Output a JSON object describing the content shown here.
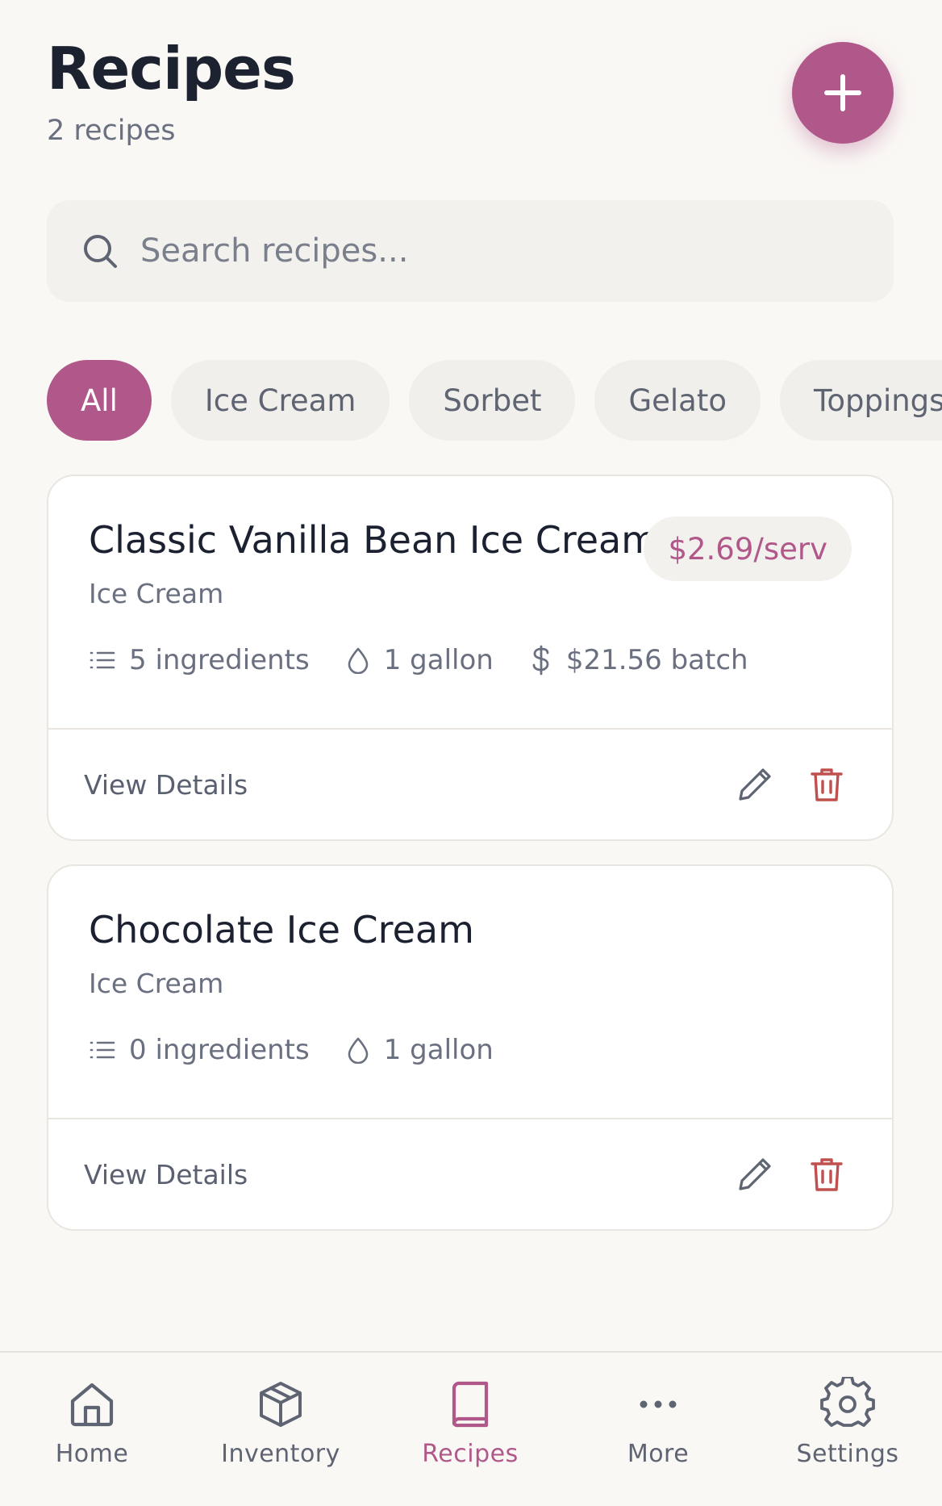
{
  "header": {
    "title": "Recipes",
    "count": "2 recipes"
  },
  "search": {
    "placeholder": "Search recipes..."
  },
  "filters": [
    "All",
    "Ice Cream",
    "Sorbet",
    "Gelato",
    "Toppings"
  ],
  "recipes": [
    {
      "title": "Classic Vanilla Bean Ice Cream",
      "price_per_serving": "$2.69/serv",
      "category": "Ice Cream",
      "ingredients": "5 ingredients",
      "yield": "1 gallon",
      "batch_cost": "$21.56 batch",
      "action_label": "View Details"
    },
    {
      "title": "Chocolate Ice Cream",
      "category": "Ice Cream",
      "ingredients": "0 ingredients",
      "yield": "1 gallon",
      "action_label": "View Details"
    }
  ],
  "nav": [
    {
      "label": "Home",
      "icon": "home-icon"
    },
    {
      "label": "Inventory",
      "icon": "box-icon"
    },
    {
      "label": "Recipes",
      "icon": "book-icon",
      "active": true
    },
    {
      "label": "More",
      "icon": "more-icon"
    },
    {
      "label": "Settings",
      "icon": "gear-icon"
    }
  ],
  "colors": {
    "accent": "#b0588a",
    "danger": "#c0504d",
    "background": "#faf8f5"
  }
}
